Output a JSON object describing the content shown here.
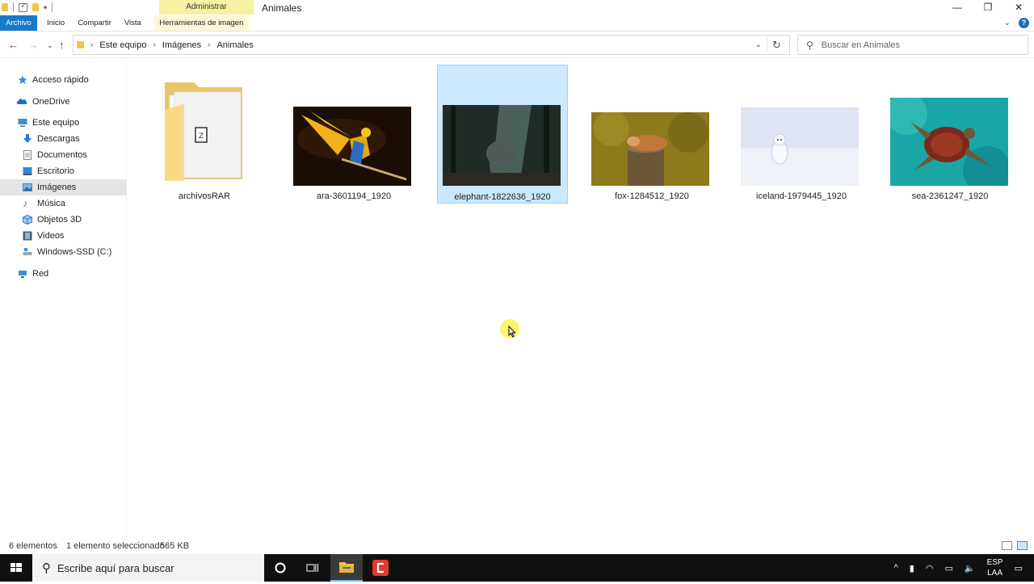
{
  "titlebar": {
    "context_group": "Administrar",
    "window_title": "Animales",
    "minimize": "—",
    "maximize": "❐",
    "close": "✕"
  },
  "ribbon": {
    "tabs": [
      "Archivo",
      "Inicio",
      "Compartir",
      "Vista"
    ],
    "context_tab": "Herramientas de imagen",
    "help": "?"
  },
  "address": {
    "crumbs": [
      "Este equipo",
      "Imágenes",
      "Animales"
    ],
    "search_placeholder": "Buscar en Animales"
  },
  "navpane": {
    "quick_access": "Acceso rápido",
    "onedrive": "OneDrive",
    "this_pc": "Este equipo",
    "items": [
      "Descargas",
      "Documentos",
      "Escritorio",
      "Imágenes",
      "Música",
      "Objetos 3D",
      "Videos",
      "Windows-SSD (C:)"
    ],
    "network": "Red",
    "selected": "Imágenes"
  },
  "files": [
    {
      "name": "archivosRAR",
      "type": "folder"
    },
    {
      "name": "ara-3601194_1920",
      "type": "image",
      "subject": "parrot"
    },
    {
      "name": "elephant-1822636_1920",
      "type": "image",
      "subject": "elephant",
      "selected": true
    },
    {
      "name": "fox-1284512_1920",
      "type": "image",
      "subject": "fox"
    },
    {
      "name": "iceland-1979445_1920",
      "type": "image",
      "subject": "arctic-fox"
    },
    {
      "name": "sea-2361247_1920",
      "type": "image",
      "subject": "turtle"
    }
  ],
  "status": {
    "count": "6 elementos",
    "selection": "1 elemento seleccionado",
    "size": "565 KB"
  },
  "taskbar": {
    "search_placeholder": "Escribe aquí para buscar",
    "lang_top": "ESP",
    "lang_bottom": "LAA"
  },
  "colors": {
    "file_tab": "#1979ca",
    "selection": "#cce8ff",
    "selection_border": "#99d1ff",
    "context_group": "#f6f1a3",
    "taskbar": "#101010"
  }
}
